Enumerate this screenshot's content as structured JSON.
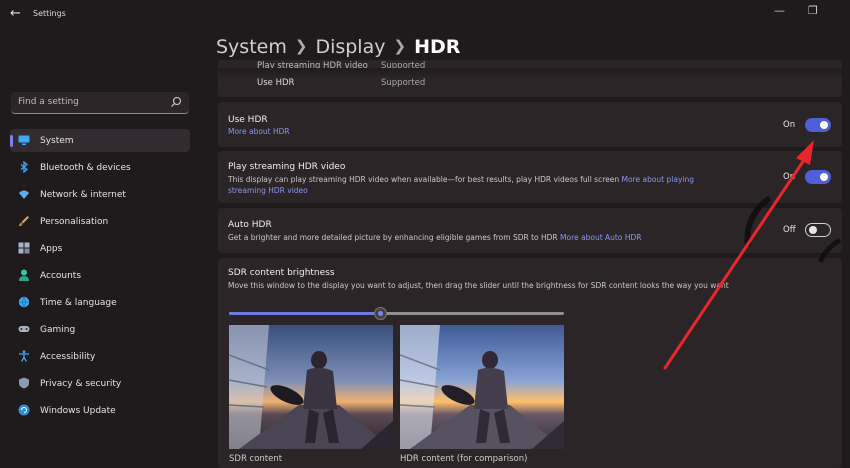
{
  "app": {
    "title": "Settings"
  },
  "breadcrumb": {
    "part1": "System",
    "part2": "Display",
    "current": "HDR"
  },
  "search": {
    "placeholder": "Find a setting"
  },
  "nav": [
    {
      "label": "System",
      "icon": "monitor-icon",
      "active": true
    },
    {
      "label": "Bluetooth & devices",
      "icon": "bluetooth-icon"
    },
    {
      "label": "Network & internet",
      "icon": "wifi-icon"
    },
    {
      "label": "Personalisation",
      "icon": "brush-icon"
    },
    {
      "label": "Apps",
      "icon": "apps-icon"
    },
    {
      "label": "Accounts",
      "icon": "person-icon"
    },
    {
      "label": "Time & language",
      "icon": "globe-clock-icon"
    },
    {
      "label": "Gaming",
      "icon": "gamepad-icon"
    },
    {
      "label": "Accessibility",
      "icon": "accessibility-icon"
    },
    {
      "label": "Privacy & security",
      "icon": "shield-icon"
    },
    {
      "label": "Windows Update",
      "icon": "refresh-icon"
    }
  ],
  "capabilities": {
    "row1_label": "Play streaming HDR video",
    "row1_value": "Supported",
    "row2_label": "Use HDR",
    "row2_value": "Supported"
  },
  "use_hdr": {
    "title": "Use HDR",
    "link": "More about HDR",
    "state": "On"
  },
  "streaming": {
    "title": "Play streaming HDR video",
    "desc": "This display can play streaming HDR video when available—for best results, play HDR videos full screen",
    "link": "More about playing streaming HDR video",
    "state": "On"
  },
  "auto_hdr": {
    "title": "Auto HDR",
    "desc": "Get a brighter and more detailed picture by enhancing eligible games from SDR to HDR",
    "link": "More about Auto HDR",
    "state": "Off"
  },
  "sdr": {
    "title": "SDR content brightness",
    "desc": "Move this window to the display you want to adjust, then drag the slider until the brightness for SDR content looks the way you want",
    "slider_fraction": 0.45,
    "caption_sdr": "SDR content",
    "caption_hdr": "HDR content (for comparison)"
  },
  "colors": {
    "accent": "#4f5fd8",
    "link": "#8b96ee",
    "annotation_arrow": "#e8262b"
  }
}
